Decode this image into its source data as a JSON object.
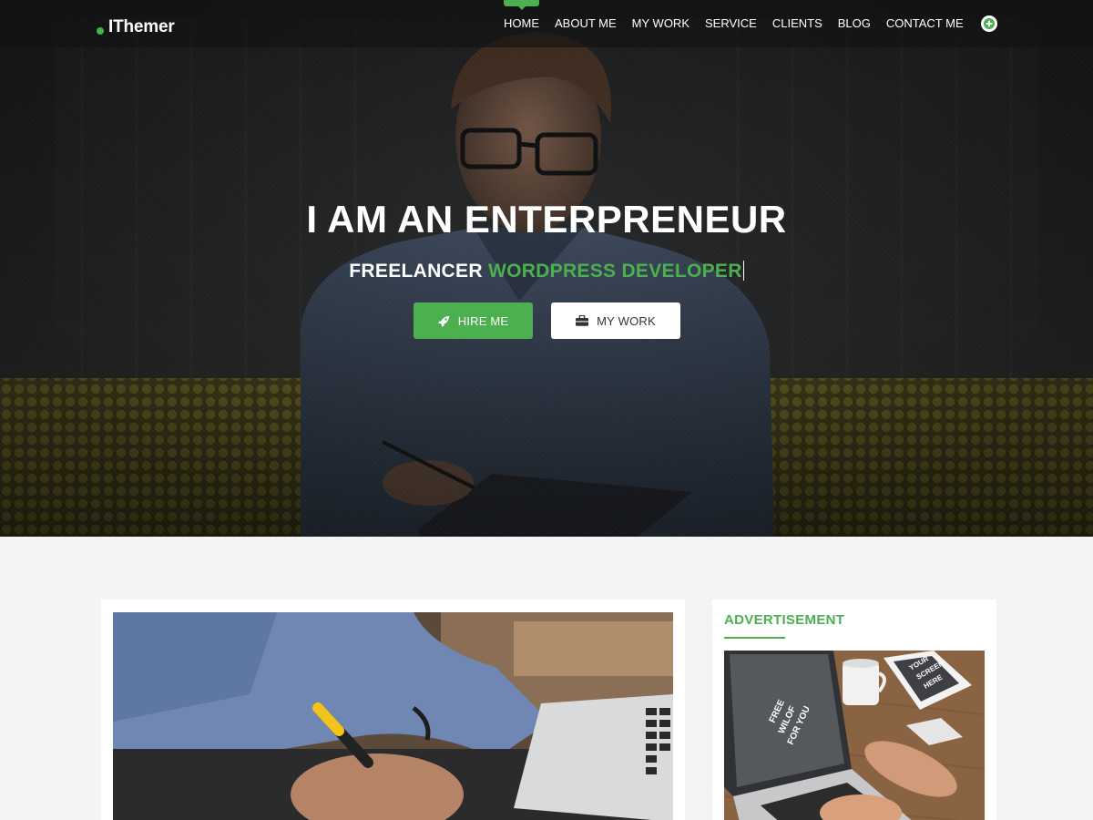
{
  "brand": {
    "name": "IThemer",
    "accent": "#4caf50"
  },
  "nav": {
    "items": [
      {
        "label": "HOME",
        "active": true
      },
      {
        "label": "ABOUT ME"
      },
      {
        "label": "MY WORK"
      },
      {
        "label": "SERVICE"
      },
      {
        "label": "CLIENTS"
      },
      {
        "label": "BLOG"
      },
      {
        "label": "CONTACT ME"
      }
    ],
    "plus_icon": "plus-circle-icon"
  },
  "hero": {
    "headline": "I AM AN ENTERPRENEUR",
    "subline_prefix": "FREELANCER",
    "subline_highlight": "WORDPRESS DEVELOPER",
    "buttons": {
      "hire": {
        "label": "HIRE ME",
        "icon": "rocket-icon"
      },
      "work": {
        "label": "MY WORK",
        "icon": "briefcase-icon"
      }
    }
  },
  "sidebar": {
    "widget_title": "ADVERTISEMENT",
    "ad_screen_text": [
      "YOUR",
      "SCREEN",
      "HERE"
    ],
    "ad_laptop_text": [
      "FREE",
      "WILOF",
      "FOR YOU"
    ]
  }
}
